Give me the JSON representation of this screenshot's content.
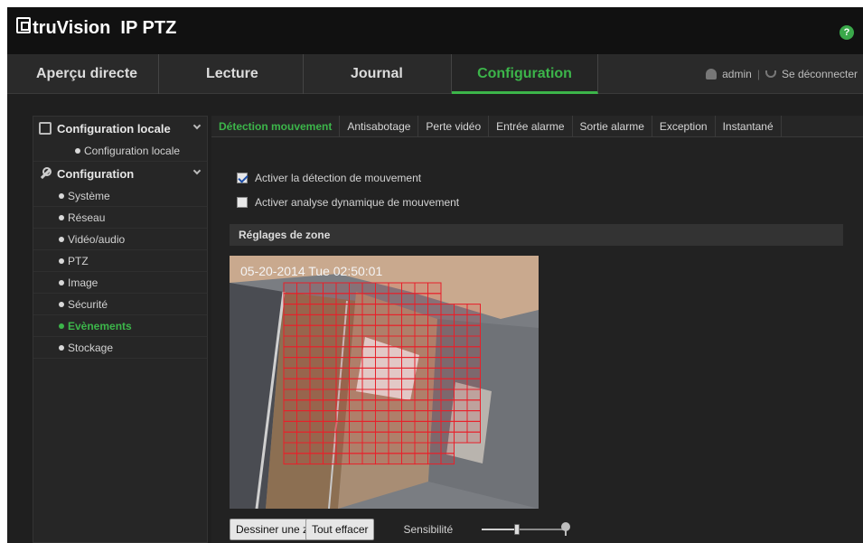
{
  "header": {
    "logo_text": "truVision  IP PTZ",
    "help_label": "?"
  },
  "nav": {
    "tabs": [
      {
        "label": "Aperçu directe"
      },
      {
        "label": "Lecture"
      },
      {
        "label": "Journal"
      },
      {
        "label": "Configuration",
        "active": true
      }
    ],
    "user": "admin",
    "separator": "|",
    "logout": "Se déconnecter"
  },
  "sidebar": {
    "groups": [
      {
        "label": "Configuration locale",
        "icon": "monitor-icon",
        "items": [
          {
            "label": "Configuration locale"
          }
        ]
      },
      {
        "label": "Configuration",
        "icon": "wrench-icon",
        "items": [
          {
            "label": "Système"
          },
          {
            "label": "Réseau"
          },
          {
            "label": "Vidéo/audio"
          },
          {
            "label": "PTZ"
          },
          {
            "label": "Image"
          },
          {
            "label": "Sécurité"
          },
          {
            "label": "Evènements",
            "active": true
          },
          {
            "label": "Stockage"
          }
        ]
      }
    ]
  },
  "subtabs": [
    {
      "label": "Détection mouvement",
      "active": true
    },
    {
      "label": "Antisabotage"
    },
    {
      "label": "Perte vidéo"
    },
    {
      "label": "Entrée alarme"
    },
    {
      "label": "Sortie alarme"
    },
    {
      "label": "Exception"
    },
    {
      "label": "Instantané"
    }
  ],
  "motion": {
    "enable_label": "Activer la détection de mouvement",
    "enable_checked": true,
    "dynamic_label": "Activer analyse dynamique de mouvement",
    "dynamic_checked": false,
    "zone_header": "Réglages de zone",
    "osd_timestamp": "05-20-2014  Tue  02:50:01",
    "draw_button": "Dessiner une zone",
    "clear_button": "Tout effacer",
    "sensitivity_label": "Sensibilité",
    "sensitivity_level": 0.42
  },
  "colors": {
    "accent": "#3cb54a",
    "grid": "#e8202a"
  }
}
